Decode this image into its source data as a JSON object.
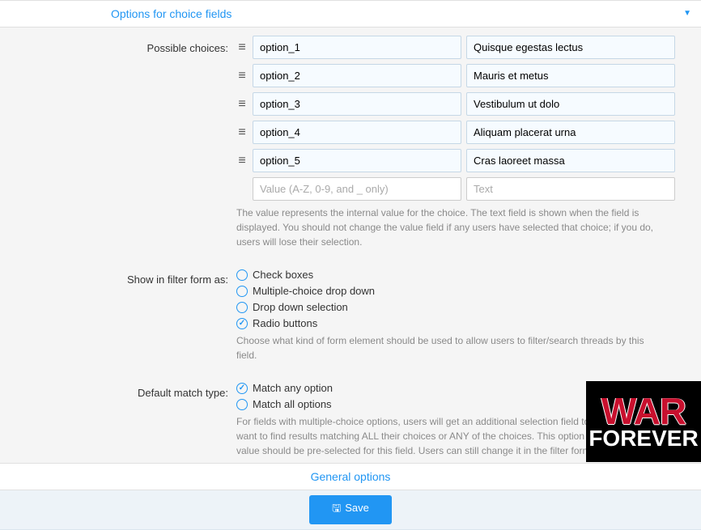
{
  "sections": {
    "choice_fields": {
      "title": "Options for choice fields",
      "possible_choices_label": "Possible choices:",
      "choices": [
        {
          "value": "option_1",
          "text": "Quisque egestas lectus"
        },
        {
          "value": "option_2",
          "text": "Mauris et metus"
        },
        {
          "value": "option_3",
          "text": "Vestibulum ut dolo"
        },
        {
          "value": "option_4",
          "text": "Aliquam placerat urna"
        },
        {
          "value": "option_5",
          "text": "Cras laoreet massa"
        }
      ],
      "new_value_placeholder": "Value (A-Z, 0-9, and _ only)",
      "new_text_placeholder": "Text",
      "choices_help": "The value represents the internal value for the choice. The text field is shown when the field is displayed. You should not change the value field if any users have selected that choice; if you do, users will lose their selection.",
      "filter_form_label": "Show in filter form as:",
      "filter_form_options": [
        {
          "label": "Check boxes",
          "checked": false
        },
        {
          "label": "Multiple-choice drop down",
          "checked": false
        },
        {
          "label": "Drop down selection",
          "checked": false
        },
        {
          "label": "Radio buttons",
          "checked": true
        }
      ],
      "filter_form_help": "Choose what kind of form element should be used to allow users to filter/search threads by this field.",
      "default_match_label": "Default match type:",
      "default_match_options": [
        {
          "label": "Match any option",
          "checked": true
        },
        {
          "label": "Match all options",
          "checked": false
        }
      ],
      "default_match_help": "For fields with multiple-choice options, users will get an additional selection field to choose, if they want to find results matching ALL their choices or ANY of the choices. This option controls which value should be pre-selected for this field. Users can still change it in the filter form."
    },
    "general": {
      "title": "General options"
    }
  },
  "save_button": "Save",
  "watermark": {
    "line1": "WAR",
    "line2": "FOREVER"
  }
}
